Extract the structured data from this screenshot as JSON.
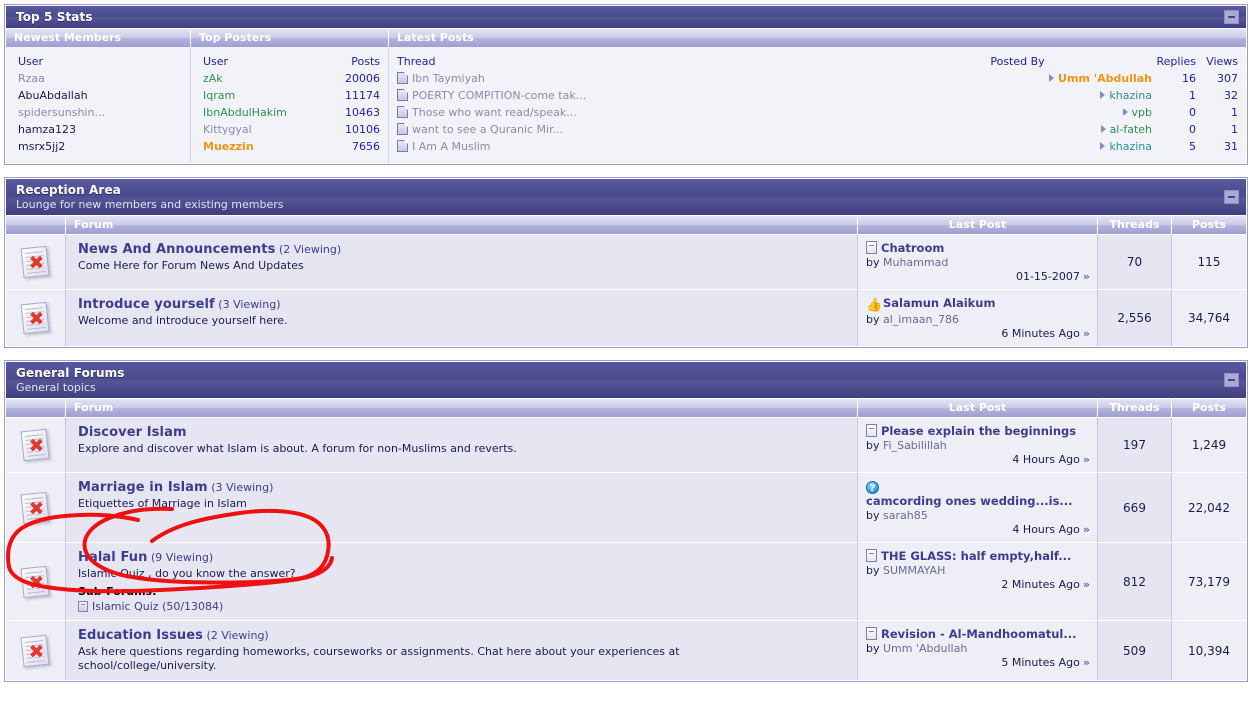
{
  "top5": {
    "title": "Top 5 Stats",
    "collapse_label": "–",
    "columns": [
      "Newest Members",
      "Top Posters",
      "Latest Posts"
    ],
    "newest_members": {
      "header": "User",
      "rows": [
        {
          "name": "Rzaa",
          "style": "grey"
        },
        {
          "name": "AbuAbdallah",
          "style": "dark"
        },
        {
          "name": "spidersunshin...",
          "style": "grey"
        },
        {
          "name": "hamza123",
          "style": "dark"
        },
        {
          "name": "msrx5jj2",
          "style": "dark"
        }
      ]
    },
    "top_posters": {
      "header_user": "User",
      "header_posts": "Posts",
      "rows": [
        {
          "name": "zAk",
          "posts": "20006",
          "style": "green"
        },
        {
          "name": "Iqram",
          "posts": "11174",
          "style": "green"
        },
        {
          "name": "IbnAbdulHakim",
          "posts": "10463",
          "style": "green"
        },
        {
          "name": "Kittygyal",
          "posts": "10106",
          "style": "grey"
        },
        {
          "name": "Muezzin",
          "posts": "7656",
          "style": "orange"
        }
      ]
    },
    "latest_posts": {
      "header_thread": "Thread",
      "header_postedby": "Posted By",
      "header_replies": "Replies",
      "header_views": "Views",
      "rows": [
        {
          "thread": "Ibn Taymiyah",
          "by": "Umm 'Abdullah",
          "by_style": "orange",
          "replies": "16",
          "views": "307"
        },
        {
          "thread": "POERTY COMPITION-come tak...",
          "by": "khazina",
          "by_style": "teal",
          "replies": "1",
          "views": "32"
        },
        {
          "thread": "Those who want read/speak...",
          "by": "vpb",
          "by_style": "green",
          "replies": "0",
          "views": "1"
        },
        {
          "thread": "want to see a Quranic Mir...",
          "by": "al-fateh",
          "by_style": "green",
          "replies": "0",
          "views": "1"
        },
        {
          "thread": "I Am A Muslim",
          "by": "khazina",
          "by_style": "teal",
          "replies": "5",
          "views": "31"
        }
      ]
    }
  },
  "reception": {
    "title": "Reception Area",
    "subtitle": "Lounge for new members and existing members",
    "collapse_label": "–",
    "columns": {
      "forum": "Forum",
      "last_post": "Last Post",
      "threads": "Threads",
      "posts": "Posts"
    },
    "rows": [
      {
        "icon": "forum-closed-icon",
        "name": "News And Announcements",
        "viewing": "(2 Viewing)",
        "desc": "Come Here for Forum News And Updates",
        "last_icon": "document-icon",
        "last_title": "Chatroom",
        "last_by_label": "by",
        "last_by": "Muhammad",
        "last_date": "01-15-2007",
        "threads": "70",
        "posts": "115"
      },
      {
        "icon": "forum-closed-icon",
        "name": "Introduce yourself",
        "viewing": "(3 Viewing)",
        "desc": "Welcome and introduce yourself here.",
        "last_icon": "thumbs-up-icon",
        "last_title": "Salamun Alaikum",
        "last_by_label": "by",
        "last_by": "al_imaan_786",
        "last_date": "6 Minutes Ago",
        "threads": "2,556",
        "posts": "34,764"
      }
    ]
  },
  "general": {
    "title": "General Forums",
    "subtitle": "General topics",
    "collapse_label": "–",
    "columns": {
      "forum": "Forum",
      "last_post": "Last Post",
      "threads": "Threads",
      "posts": "Posts"
    },
    "rows": [
      {
        "icon": "forum-closed-icon",
        "name": "Discover Islam",
        "viewing": "",
        "desc": "Explore and discover what Islam is about. A forum for non-Muslims and reverts.",
        "last_icon": "document-icon",
        "last_title": "Please explain the beginnings",
        "last_by_label": "by",
        "last_by": "Fi_Sabilillah",
        "last_date": "4 Hours Ago",
        "threads": "197",
        "posts": "1,249"
      },
      {
        "icon": "forum-closed-icon",
        "name": "Marriage in Islam",
        "viewing": "(3 Viewing)",
        "desc": "Etiquettes of Marriage in Islam",
        "last_icon": "question-icon",
        "last_title": "camcording ones wedding...is...",
        "last_by_label": "by",
        "last_by": "sarah85",
        "last_date": "4 Hours Ago",
        "threads": "669",
        "posts": "22,042",
        "annotated": true
      },
      {
        "icon": "forum-closed-icon",
        "name": "Halal Fun",
        "viewing": "(9 Viewing)",
        "desc": "Islamic Quiz , do you know the answer?",
        "subforums_label": "Sub-Forums:",
        "subforums": [
          {
            "name": "Islamic Quiz",
            "counts": "(50/13084)"
          }
        ],
        "last_icon": "document-icon",
        "last_title": "THE GLASS: half empty,half...",
        "last_by_label": "by",
        "last_by": "SUMMAYAH",
        "last_date": "2 Minutes Ago",
        "threads": "812",
        "posts": "73,179"
      },
      {
        "icon": "forum-closed-icon",
        "name": "Education Issues",
        "viewing": "(2 Viewing)",
        "desc": "Ask here questions regarding homeworks, courseworks or assignments. Chat here about your experiences at school/college/university.",
        "last_icon": "document-icon",
        "last_title": "Revision - Al-Mandhoomatul...",
        "last_by_label": "by",
        "last_by": "Umm 'Abdullah",
        "last_date": "5 Minutes Ago",
        "threads": "509",
        "posts": "10,394"
      }
    ]
  },
  "colors": {
    "panel_header": "#4a4a8e",
    "column_header": "#b4b4dd",
    "link": "#3d3d8f",
    "annotation": "#ee1111"
  }
}
